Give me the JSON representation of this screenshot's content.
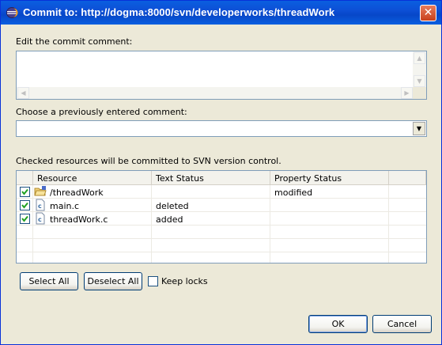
{
  "window": {
    "title": "Commit to: http://dogma:8000/svn/developerworks/threadWork"
  },
  "comment": {
    "label": "Edit the commit comment:",
    "value": ""
  },
  "previous": {
    "label": "Choose a previously entered comment:",
    "selected": ""
  },
  "resources": {
    "label": "Checked resources will be committed to SVN version control.",
    "columns": [
      "Resource",
      "Text Status",
      "Property Status"
    ],
    "rows": [
      {
        "checked": true,
        "icon": "project-folder-icon",
        "name": "/threadWork",
        "text_status": "",
        "property_status": "modified"
      },
      {
        "checked": true,
        "icon": "c-file-icon",
        "name": "main.c",
        "text_status": "deleted",
        "property_status": ""
      },
      {
        "checked": true,
        "icon": "c-file-icon",
        "name": "threadWork.c",
        "text_status": "added",
        "property_status": ""
      }
    ]
  },
  "actions": {
    "select_all": "Select All",
    "deselect_all": "Deselect All",
    "keep_locks": "Keep locks",
    "keep_locks_checked": false
  },
  "footer": {
    "ok": "OK",
    "cancel": "Cancel"
  }
}
